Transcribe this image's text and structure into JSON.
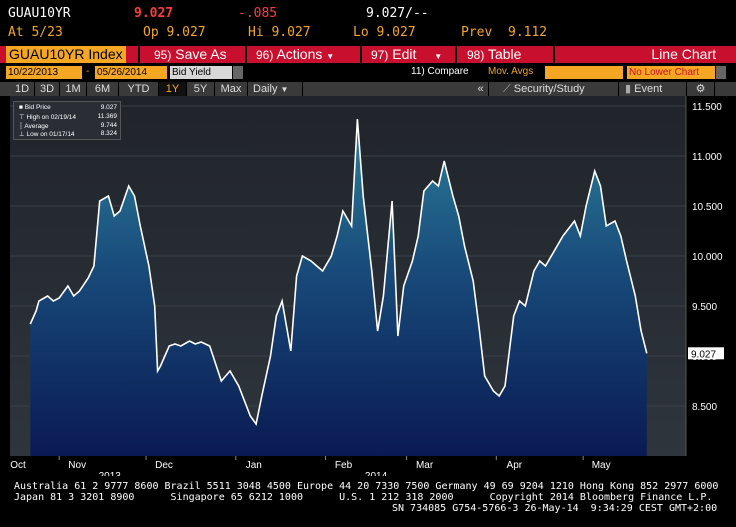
{
  "header": {
    "ticker": "GUAU10YR",
    "last": "9.027",
    "change": "-.085",
    "last_pair": "9.027/--",
    "at": "At 5/23",
    "open": "Op 9.027",
    "high": "Hi 9.027",
    "low": "Lo 9.027",
    "prev_label": "Prev",
    "prev": "9.112"
  },
  "menubar": {
    "ticker_label": "GUAU10YR Index",
    "save_num": "95)",
    "save_label": "Save As",
    "actions_num": "96)",
    "actions_label": "Actions",
    "edit_num": "97)",
    "edit_label": "Edit",
    "table_num": "98)",
    "table_label": "Table",
    "chart_type": "Line Chart"
  },
  "controls": {
    "start_date": "10/22/2013",
    "end_date": "05/26/2014",
    "field": "Bid Yield",
    "compare": "11) Compare",
    "mov_avgs": "Mov. Avgs",
    "lower_chart": "No Lower Chart"
  },
  "rangebar": {
    "ranges": [
      "1D",
      "3D",
      "1M",
      "6M",
      "YTD",
      "1Y",
      "5Y",
      "Max"
    ],
    "active": "1Y",
    "period": "Daily",
    "security_study": "Security/Study",
    "event": "Event"
  },
  "legend": {
    "bid_label": "Bid Price",
    "bid_value": "9.027",
    "high_label": "High on 02/19/14",
    "high_value": "11.369",
    "avg_label": "Average",
    "avg_value": "9.744",
    "low_label": "Low on 01/17/14",
    "low_value": "8.324"
  },
  "chart_data": {
    "type": "area",
    "title": "",
    "xlabel": "",
    "ylabel": "",
    "ylim": [
      8.0,
      11.6
    ],
    "yticks": [
      "11.500",
      "11.000",
      "10.500",
      "10.000",
      "9.500",
      "9.000",
      "8.500"
    ],
    "ytick_values": [
      11.5,
      11.0,
      10.5,
      10.0,
      9.5,
      9.0,
      8.5
    ],
    "last_value_label": "9.027",
    "x_month_labels": [
      "Oct",
      "Nov",
      "Dec",
      "Jan",
      "Feb",
      "Mar",
      "Apr",
      "May"
    ],
    "x_year_labels": [
      "2013",
      "2014"
    ],
    "x": [
      "2013-10-22",
      "2013-10-24",
      "2013-10-25",
      "2013-10-28",
      "2013-10-30",
      "2013-11-01",
      "2013-11-04",
      "2013-11-06",
      "2013-11-08",
      "2013-11-11",
      "2013-11-13",
      "2013-11-15",
      "2013-11-18",
      "2013-11-20",
      "2013-11-22",
      "2013-11-25",
      "2013-11-27",
      "2013-11-29",
      "2013-12-02",
      "2013-12-04",
      "2013-12-05",
      "2013-12-06",
      "2013-12-09",
      "2013-12-11",
      "2013-12-13",
      "2013-12-16",
      "2013-12-18",
      "2013-12-20",
      "2013-12-23",
      "2013-12-27",
      "2013-12-30",
      "2014-01-02",
      "2014-01-06",
      "2014-01-08",
      "2014-01-10",
      "2014-01-13",
      "2014-01-15",
      "2014-01-17",
      "2014-01-20",
      "2014-01-22",
      "2014-01-24",
      "2014-01-27",
      "2014-01-29",
      "2014-01-31",
      "2014-02-03",
      "2014-02-05",
      "2014-02-07",
      "2014-02-10",
      "2014-02-12",
      "2014-02-14",
      "2014-02-17",
      "2014-02-19",
      "2014-02-21",
      "2014-02-24",
      "2014-02-26",
      "2014-02-28",
      "2014-03-03",
      "2014-03-05",
      "2014-03-07",
      "2014-03-10",
      "2014-03-12",
      "2014-03-14",
      "2014-03-17",
      "2014-03-19",
      "2014-03-21",
      "2014-03-24",
      "2014-03-26",
      "2014-03-28",
      "2014-03-31",
      "2014-04-02",
      "2014-04-04",
      "2014-04-07",
      "2014-04-09",
      "2014-04-11",
      "2014-04-14",
      "2014-04-16",
      "2014-04-18",
      "2014-04-22",
      "2014-04-24",
      "2014-04-28",
      "2014-04-30",
      "2014-05-02",
      "2014-05-05",
      "2014-05-07",
      "2014-05-09",
      "2014-05-12",
      "2014-05-14",
      "2014-05-16",
      "2014-05-19",
      "2014-05-21",
      "2014-05-23"
    ],
    "values": [
      9.32,
      9.45,
      9.55,
      9.6,
      9.55,
      9.58,
      9.7,
      9.6,
      9.65,
      9.78,
      9.9,
      10.55,
      10.6,
      10.4,
      10.45,
      10.7,
      10.6,
      10.3,
      9.9,
      9.5,
      8.85,
      8.9,
      9.1,
      9.12,
      9.1,
      9.15,
      9.12,
      9.14,
      9.1,
      8.75,
      8.85,
      8.7,
      8.4,
      8.32,
      8.6,
      9.0,
      9.4,
      9.55,
      9.05,
      9.8,
      10.0,
      9.95,
      9.9,
      9.85,
      10.0,
      10.2,
      10.45,
      10.3,
      11.37,
      10.6,
      9.85,
      9.25,
      9.6,
      10.55,
      9.2,
      9.7,
      9.95,
      10.2,
      10.65,
      10.75,
      10.7,
      10.95,
      10.6,
      10.4,
      10.1,
      9.75,
      9.3,
      8.8,
      8.65,
      8.6,
      8.7,
      9.4,
      9.55,
      9.5,
      9.85,
      9.95,
      9.9,
      10.1,
      10.2,
      10.35,
      10.2,
      10.5,
      10.85,
      10.7,
      10.3,
      10.35,
      10.2,
      9.95,
      9.6,
      9.25,
      9.027
    ]
  },
  "footer": {
    "line1": "Australia 61 2 9777 8600 Brazil 5511 3048 4500 Europe 44 20 7330 7500 Germany 49 69 9204 1210 Hong Kong 852 2977 6000",
    "line2": "Japan 81 3 3201 8900      Singapore 65 6212 1000      U.S. 1 212 318 2000      Copyright 2014 Bloomberg Finance L.P.",
    "line3": "SN 734085 G754-5766-3 26-May-14  9:34:29 CEST GMT+2:00"
  },
  "colors": {
    "accent": "#f5a623",
    "menu_red": "#c8102e",
    "down": "#ff3b3b"
  }
}
